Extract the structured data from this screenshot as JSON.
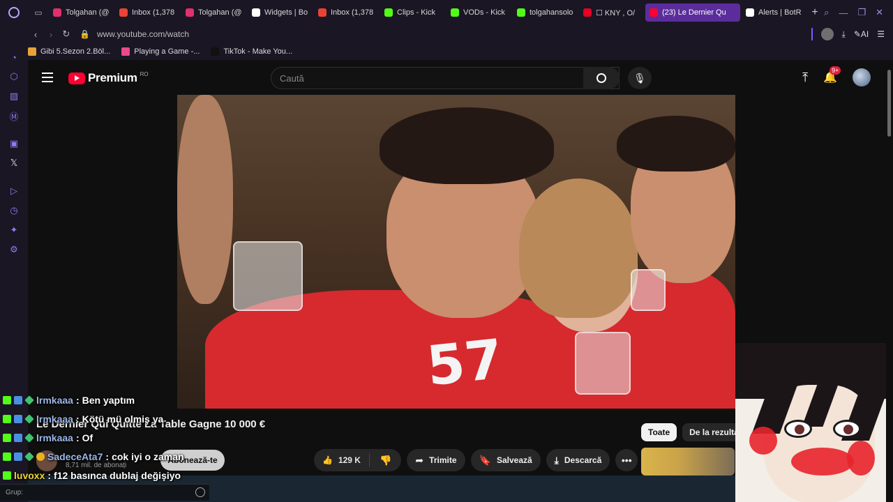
{
  "browser": {
    "tabs": [
      {
        "label": "Tolgahan (@",
        "favicon": "instagram",
        "color": "#e1306c"
      },
      {
        "label": "Inbox (1,378",
        "favicon": "gmail",
        "color": "#ea4335"
      },
      {
        "label": "Tolgahan (@",
        "favicon": "instagram",
        "color": "#e1306c"
      },
      {
        "label": "Widgets | Bo",
        "favicon": "botrix",
        "color": "#ffffff"
      },
      {
        "label": "Inbox (1,378",
        "favicon": "gmail",
        "color": "#ea4335"
      },
      {
        "label": "Clips - Kick",
        "favicon": "kick",
        "color": "#53fc18"
      },
      {
        "label": "VODs - Kick",
        "favicon": "kick",
        "color": "#53fc18"
      },
      {
        "label": "tolgahansolo",
        "favicon": "kick",
        "color": "#53fc18"
      },
      {
        "label": "☐ KNY , O/",
        "favicon": "pinterest",
        "color": "#e60023"
      },
      {
        "label": "(23) Le Dernier Qu",
        "favicon": "youtube",
        "color": "#ff0033",
        "active": true
      },
      {
        "label": "Alerts | BotR",
        "favicon": "botrix",
        "color": "#ffffff"
      }
    ],
    "url": "www.youtube.com/watch",
    "ai_label": "AI",
    "bookmarks": [
      {
        "label": "Gibi 5.Sezon 2.Böl...",
        "color": "#e8a23a"
      },
      {
        "label": "Playing a Game -...",
        "color": "#e84a8a"
      },
      {
        "label": "TikTok - Make You...",
        "color": "#111111"
      }
    ]
  },
  "youtube": {
    "brand": "Premium",
    "region": "RO",
    "search_placeholder": "Caută",
    "notif_count": "9+",
    "video": {
      "title": "Le Dernier Qui Quitte La Table Gagne 10 000 €",
      "subscribers": "8,71 mil. de abonați",
      "subscribe_label": "Abonează-te",
      "likes": "129 K",
      "share_label": "Trimite",
      "save_label": "Salvează",
      "download_label": "Descarcă",
      "shirt_number": "57"
    },
    "chips": [
      "Toate",
      "De la rezultat"
    ]
  },
  "chat": {
    "messages": [
      {
        "user": "lrmkaaa",
        "text": "Ben yaptım",
        "badges": [
          "kick",
          "blue",
          "green"
        ]
      },
      {
        "user": "lrmkaaa",
        "text": "Kötü mü olmiş ya",
        "badges": [
          "kick",
          "blue",
          "green"
        ]
      },
      {
        "user": "lrmkaaa",
        "text": "Of",
        "badges": [
          "kick",
          "blue",
          "green"
        ]
      },
      {
        "user": "SadeceAta7",
        "text": "cok iyi o zaman",
        "badges": [
          "kick",
          "blue",
          "green",
          "gold"
        ]
      },
      {
        "user": "luvoxx",
        "text": "f12 basınca dublaj değişiyo",
        "badges": [
          "kick"
        ],
        "yellow": true
      }
    ],
    "input_label": "Grup:"
  }
}
